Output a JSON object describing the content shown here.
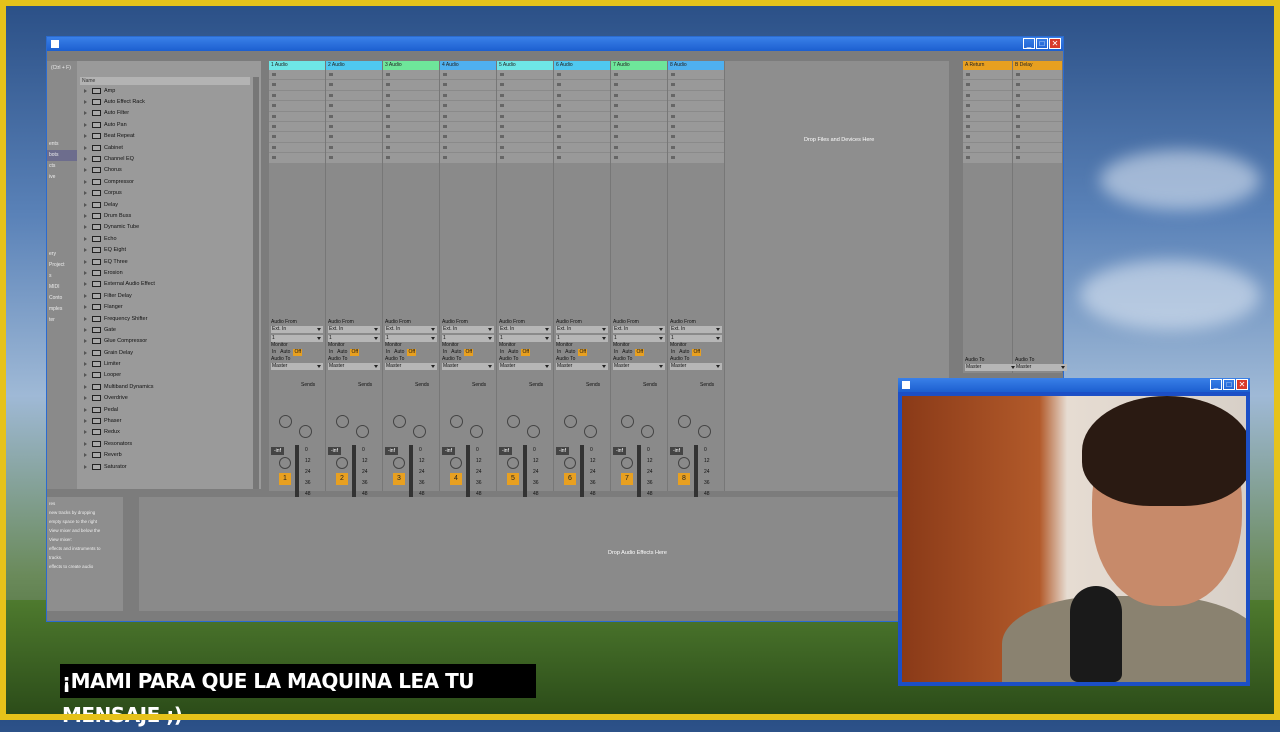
{
  "browser": {
    "search_hint": "(Ctrl + F)",
    "name_header": "Name",
    "places": [
      "ents",
      "bots",
      "cts",
      "ive",
      "",
      "ery",
      "Project",
      "s",
      "MIDI",
      "Conto",
      "mples",
      "ter"
    ],
    "items": [
      "Amp",
      "Auto Effect Rack",
      "Auto Filter",
      "Auto Pan",
      "Beat Repeat",
      "Cabinet",
      "Channel EQ",
      "Chorus",
      "Compressor",
      "Corpus",
      "Delay",
      "Drum Buss",
      "Dynamic Tube",
      "Echo",
      "EQ Eight",
      "EQ Three",
      "Erosion",
      "External Audio Effect",
      "Filter Delay",
      "Flanger",
      "Frequency Shifter",
      "Gate",
      "Glue Compressor",
      "Grain Delay",
      "Limiter",
      "Looper",
      "Multiband Dynamics",
      "Overdrive",
      "Pedal",
      "Phaser",
      "Redux",
      "Resonators",
      "Reverb",
      "Saturator"
    ]
  },
  "tracks": [
    {
      "name": "1 Audio",
      "color": "#6ee6e6",
      "num": "1"
    },
    {
      "name": "2 Audio",
      "color": "#4fc8f0",
      "num": "2"
    },
    {
      "name": "3 Audio",
      "color": "#6ee69a",
      "num": "3"
    },
    {
      "name": "4 Audio",
      "color": "#4fb0f0",
      "num": "4"
    },
    {
      "name": "5 Audio",
      "color": "#6ee6e6",
      "num": "5"
    },
    {
      "name": "6 Audio",
      "color": "#4fc8f0",
      "num": "6"
    },
    {
      "name": "7 Audio",
      "color": "#6ee69a",
      "num": "7"
    },
    {
      "name": "8 Audio",
      "color": "#4fb0f0",
      "num": "8"
    }
  ],
  "io": {
    "audio_from": "Audio From",
    "ext_in": "Ext. In",
    "input_ch": "1",
    "monitor": "Monitor",
    "mon_in": "In",
    "mon_auto": "Auto",
    "mon_off": "Off",
    "audio_to": "Audio To",
    "master": "Master",
    "sends": "Sends",
    "send_a": "A",
    "send_b": "B",
    "vol": "-inf",
    "scale": [
      "0",
      "12",
      "24",
      "36",
      "48",
      "60"
    ]
  },
  "returns": [
    {
      "name": "A Return",
      "color": "#e8a020"
    },
    {
      "name": "B Delay",
      "color": "#e8a020"
    }
  ],
  "drop_files": "Drop Files and Devices Here",
  "drop_effects": "Drop Audio Effects Here",
  "info_text": [
    "res",
    "new tracks by dropping",
    "empty space to the right",
    "View mixer and below the",
    "View mixer:",
    "effects and instruments to",
    "tracks.",
    "effects to create audio"
  ],
  "caption": "¡MAMI PARA QUE LA MAQUINA LEA TU MENSAJE ;)"
}
